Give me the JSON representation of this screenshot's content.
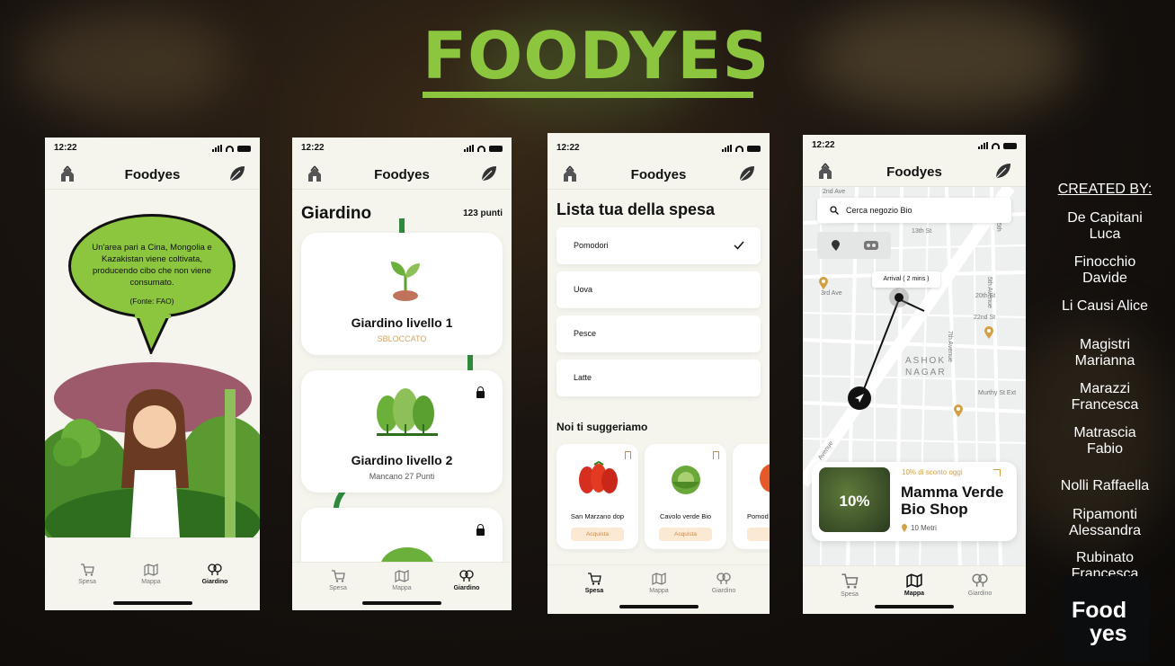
{
  "title": "FOODYES",
  "status_time": "12:22",
  "app_logo": "Foodyes",
  "tabs": {
    "spesa": "Spesa",
    "mappa": "Mappa",
    "giardino": "Giardino"
  },
  "phone1": {
    "bubble_text": "Un'area pari a Cina, Mongolia e Kazakistan viene coltivata, producendo cibo che non viene consumato.",
    "bubble_source": "(Fonte: FAO)"
  },
  "phone2": {
    "heading": "Giardino",
    "points": "123 punti",
    "levels": [
      {
        "title": "Giardino livello 1",
        "status": "SBLOCCATO"
      },
      {
        "title": "Giardino livello 2",
        "status": "Mancano 27 Punti"
      }
    ]
  },
  "phone3": {
    "heading": "Lista tua della spesa",
    "items": [
      "Pomodori",
      "Uova",
      "Pesce",
      "Latte"
    ],
    "suggest_heading": "Noi ti suggeriamo",
    "products": [
      {
        "name": "San Marzano dop",
        "button": "Acquista"
      },
      {
        "name": "Cavolo verde Bio",
        "button": "Acquista"
      },
      {
        "name": "Pomod",
        "button": "Ac"
      }
    ]
  },
  "phone4": {
    "search_placeholder": "Cerca negozio Bio",
    "arrival": "Arrival  ( 2 mins )",
    "streets": [
      "2nd Ave",
      "3rd Ave",
      "13th St",
      "20th St",
      "22nd St",
      "5th Avenue",
      "7th Avenue",
      "Murthy St Ext",
      "Avenue",
      "15th"
    ],
    "area": [
      "ASHOK",
      "NAGAR"
    ],
    "shop": {
      "discount_tag": "10% di sconto oggi",
      "badge": "10%",
      "name_line1": "Mamma Verde",
      "name_line2": "Bio Shop",
      "distance": "10 Metri"
    }
  },
  "credits": {
    "heading": "CREATED BY:",
    "members": [
      "De Capitani\nLuca",
      "Finocchio\nDavide",
      "Li Causi Alice",
      "Magistri\nMarianna",
      "Marazzi\nFrancesca",
      "Matrascia\nFabio",
      "Nolli Raffaella",
      "Ripamonti\nAlessandra",
      "Rubinato\nFrancesca"
    ]
  },
  "logo_tile": {
    "line1": "Food",
    "line2": "yes"
  },
  "colors": {
    "brand_green": "#8cc63f",
    "accent_orange": "#c98c4a",
    "phone_bg": "#f5f5ee"
  }
}
